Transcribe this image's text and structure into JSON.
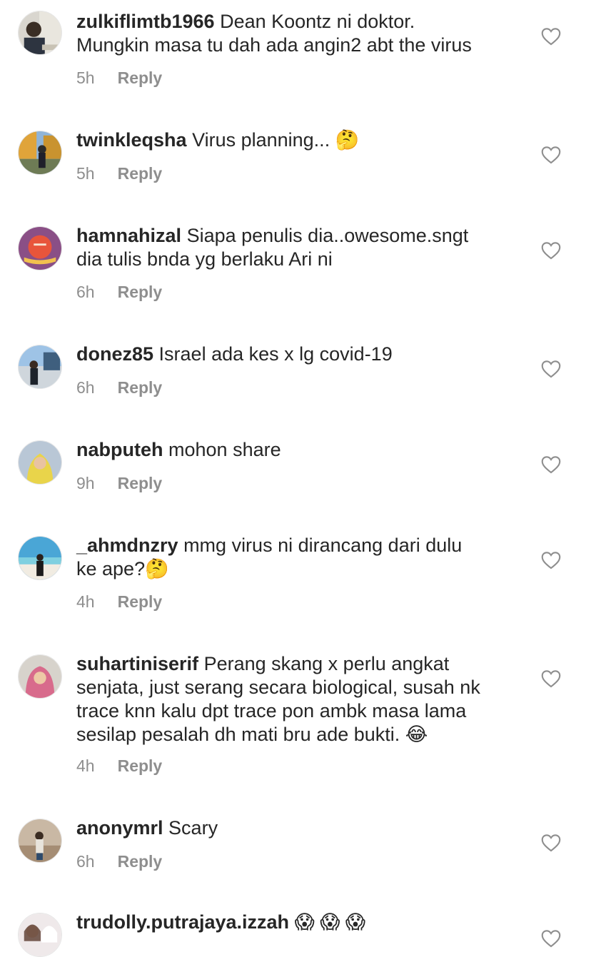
{
  "comments": [
    {
      "username": "zulkiflimtb1966",
      "text": "Dean Koontz ni doktor.\nMungkin masa tu dah ada angin2 abt the virus",
      "time": "5h",
      "reply_label": "Reply"
    },
    {
      "username": "twinkleqsha",
      "text": "Virus planning... 🤔",
      "time": "5h",
      "reply_label": "Reply"
    },
    {
      "username": "hamnahizal",
      "text": "Siapa penulis dia..owesome.sngt\ndia tulis bnda yg berlaku Ari ni",
      "time": "6h",
      "reply_label": "Reply"
    },
    {
      "username": "donez85",
      "text": "Israel ada kes x lg covid-19",
      "time": "6h",
      "reply_label": "Reply"
    },
    {
      "username": "nabputeh",
      "text": "mohon share",
      "time": "9h",
      "reply_label": "Reply"
    },
    {
      "username": "_ahmdnzry",
      "text": "mmg virus ni dirancang dari dulu\nke ape?🤔",
      "time": "4h",
      "reply_label": "Reply"
    },
    {
      "username": "suhartiniserif",
      "text": "Perang skang x perlu angkat\nsenjata, just serang secara biological, susah nk\ntrace knn kalu dpt trace pon ambk masa lama\nsesilap pesalah dh mati bru ade bukti. 😂",
      "time": "4h",
      "reply_label": "Reply"
    },
    {
      "username": "anonymrl",
      "text": "Scary",
      "time": "6h",
      "reply_label": "Reply"
    },
    {
      "username": "trudolly.putrajaya.izzah",
      "text": "😱 😱 😱",
      "time": "",
      "reply_label": ""
    }
  ],
  "icons": {
    "like": "heart-outline-icon",
    "avatar": "avatar-photo"
  },
  "colors": {
    "text": "#262626",
    "secondary": "#8e8e8e",
    "background": "#ffffff"
  }
}
